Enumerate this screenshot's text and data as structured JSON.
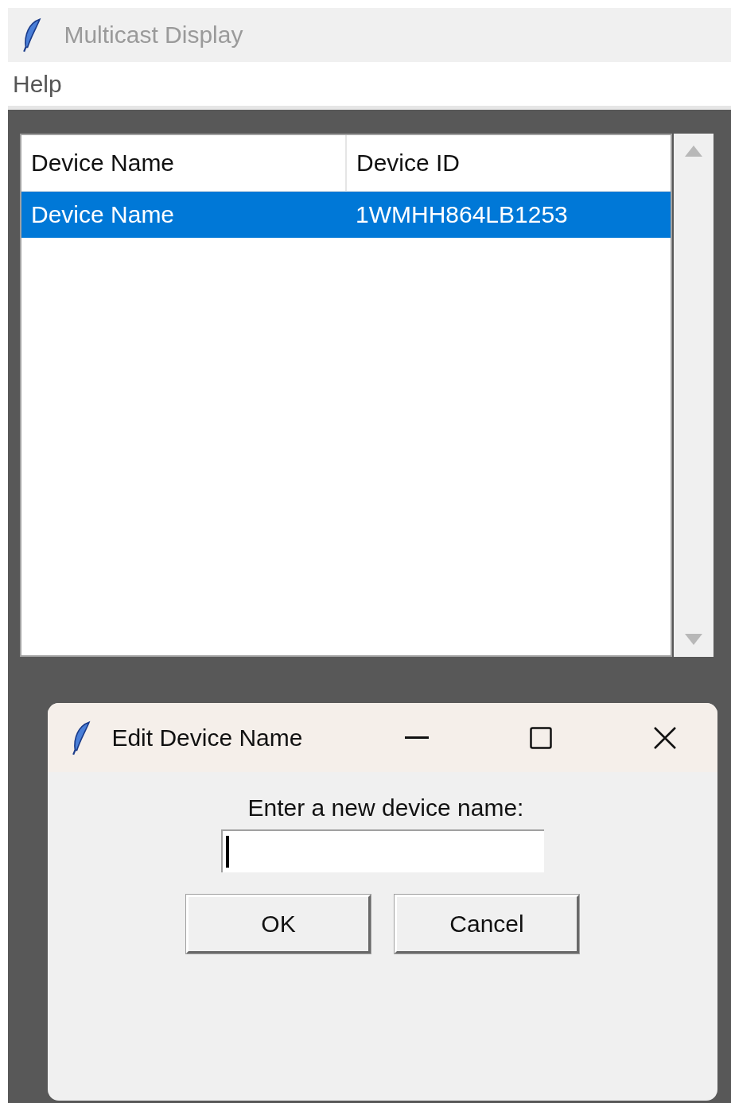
{
  "window": {
    "title": "Multicast Display"
  },
  "menu": [
    "Help"
  ],
  "table": {
    "columns": [
      "Device Name",
      "Device ID"
    ],
    "rows": [
      {
        "cells": [
          "Device Name",
          "1WMHH864LB1253"
        ],
        "selected": true
      }
    ]
  },
  "dialog": {
    "title": "Edit Device Name",
    "label": "Enter a new device name:",
    "field": {
      "focused": true
    },
    "buttons": [
      "OK",
      "Cancel"
    ]
  }
}
